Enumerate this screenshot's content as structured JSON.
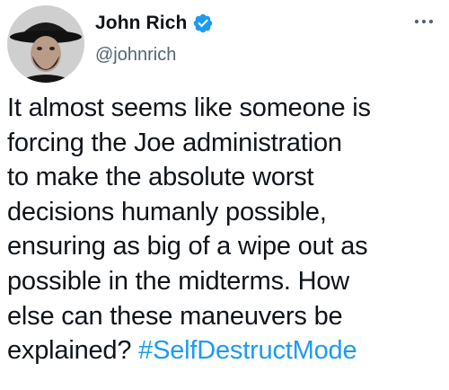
{
  "author": {
    "display_name": "John Rich",
    "handle": "@johnrich",
    "verified": true
  },
  "tweet": {
    "lines": [
      "It almost seems like someone is",
      "forcing the Joe administration",
      "to make the absolute worst",
      "decisions humanly possible,",
      "ensuring as big of a wipe out as",
      "possible in the midterms. How",
      "else can these maneuvers be"
    ],
    "last_line_text": "explained? ",
    "hashtag": "#SelfDestructMode"
  },
  "colors": {
    "text": "#0f1419",
    "secondary": "#536471",
    "accent": "#1d9bf0"
  },
  "icons": {
    "verified": "verified-badge-icon",
    "more": "more-options-icon"
  }
}
